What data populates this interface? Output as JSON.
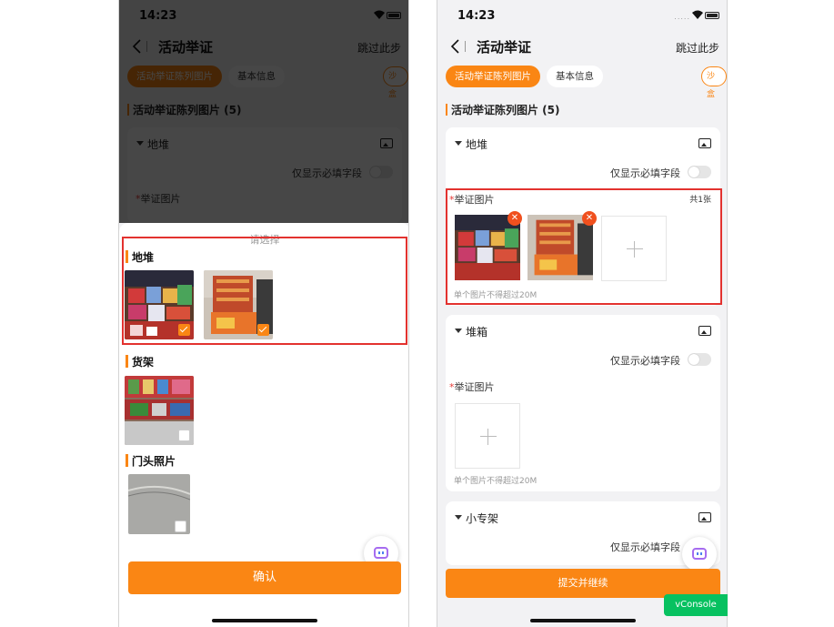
{
  "status_bar": {
    "time": "14:23",
    "signal": "....."
  },
  "nav": {
    "title": "活动举证",
    "skip_label": "跳过此步"
  },
  "tabs": [
    {
      "label": "活动举证陈列图片"
    },
    {
      "label": "基本信息"
    },
    {
      "label": "沙盒"
    }
  ],
  "section_title": "活动举证陈列图片 (5)",
  "sheet": {
    "title": "请选择",
    "groups": [
      {
        "title": "地堆",
        "images": [
          {
            "checked": true
          },
          {
            "checked": true
          }
        ]
      },
      {
        "title": "货架",
        "images": [
          {
            "checked": false
          }
        ]
      },
      {
        "title": "门头照片",
        "images": [
          {
            "checked": false
          }
        ]
      }
    ],
    "confirm_label": "确认"
  },
  "cards": [
    {
      "title": "地堆",
      "toggle_label": "仅显示必填字段",
      "field_label": "举证图片",
      "required_mark": "*",
      "count": "共1张",
      "hint": "单个图片不得超过20M"
    },
    {
      "title": "堆箱",
      "toggle_label": "仅显示必填字段",
      "field_label": "举证图片",
      "required_mark": "*",
      "hint": "单个图片不得超过20M"
    },
    {
      "title": "小专架",
      "toggle_label": "仅显示必填字段"
    }
  ],
  "submit_label": "提交并继续",
  "vconsole_label": "vConsole",
  "colors": {
    "accent": "#fa8614",
    "highlight_border": "#e3322f",
    "delete_badge": "#f0501e",
    "vconsole": "#07c160"
  }
}
